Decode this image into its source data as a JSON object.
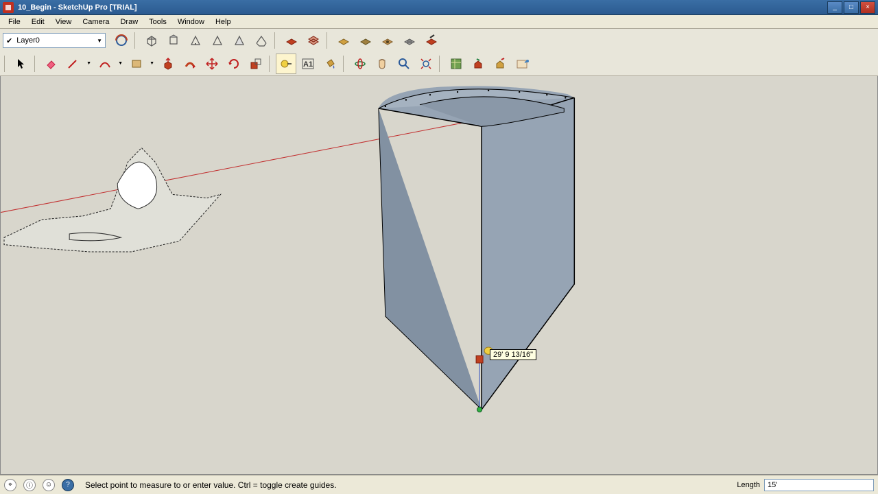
{
  "window": {
    "title": "10_Begin - SketchUp Pro [TRIAL]"
  },
  "menu": [
    "File",
    "Edit",
    "View",
    "Camera",
    "Draw",
    "Tools",
    "Window",
    "Help"
  ],
  "layer": {
    "name": "Layer0"
  },
  "measurement": {
    "tooltip": "29' 9 13/16\""
  },
  "status": {
    "hint": "Select point to measure to or enter value.  Ctrl = toggle create guides.",
    "vcb_label": "Length",
    "vcb_value": "15'"
  }
}
